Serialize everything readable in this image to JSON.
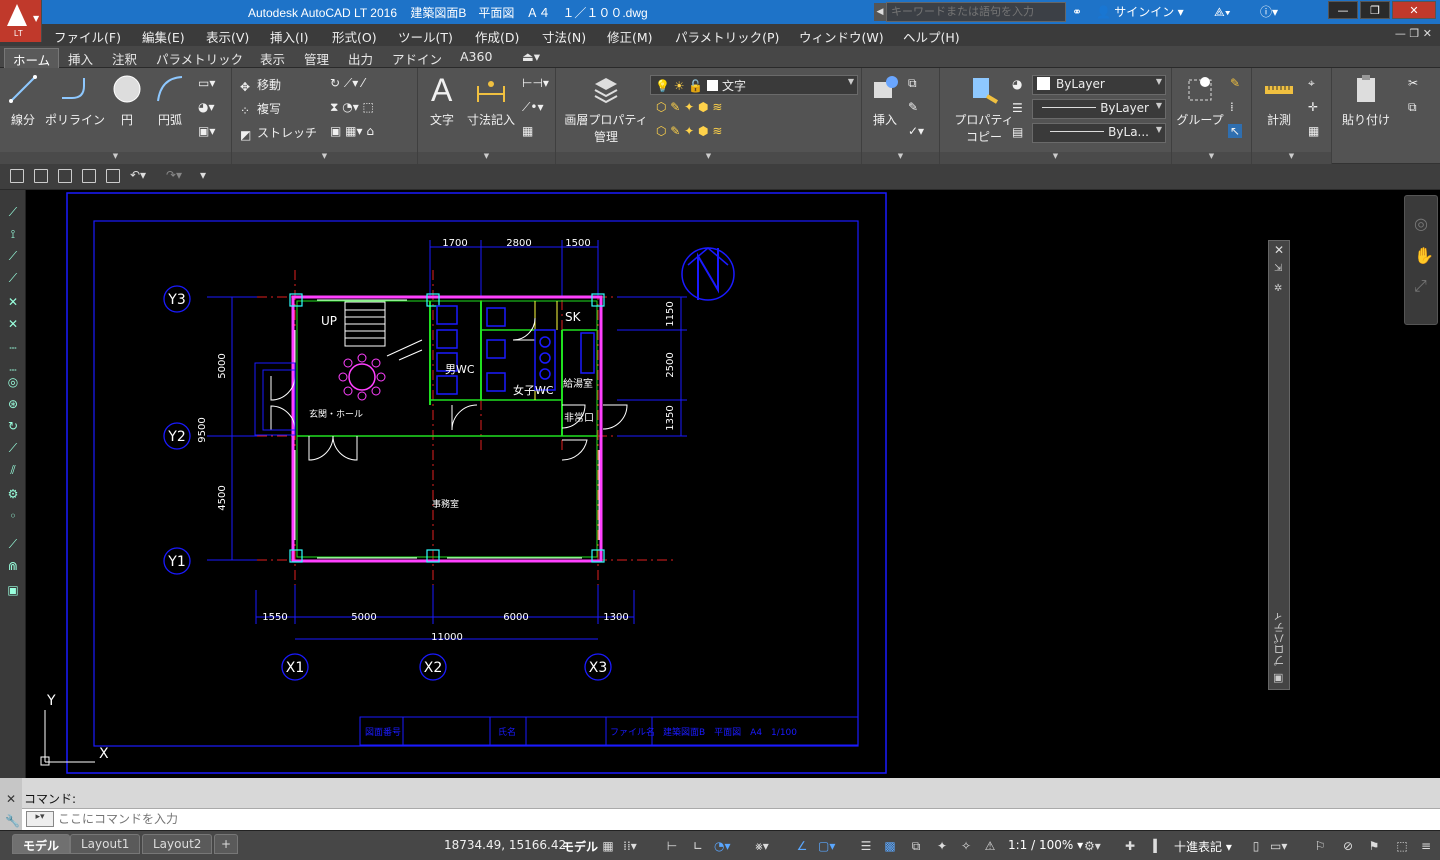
{
  "titlebar": {
    "title": "Autodesk AutoCAD LT 2016    建築図面B　平面図　Ａ４　１／１００.dwg",
    "logo_text": "LT",
    "search_placeholder": "キーワードまたは語句を入力",
    "signin": "サインイン"
  },
  "menu": {
    "items": [
      "ファイル(F)",
      "編集(E)",
      "表示(V)",
      "挿入(I)",
      "形式(O)",
      "ツール(T)",
      "作成(D)",
      "寸法(N)",
      "修正(M)",
      "パラメトリック(P)",
      "ウィンドウ(W)",
      "ヘルプ(H)"
    ]
  },
  "ribbon_tabs": [
    "ホーム",
    "挿入",
    "注釈",
    "パラメトリック",
    "表示",
    "管理",
    "出力",
    "アドイン",
    "A360"
  ],
  "ribbon": {
    "draw": {
      "line": "線分",
      "polyline": "ポリライン",
      "circle": "円",
      "arc": "円弧"
    },
    "modify": {
      "move": "移動",
      "copy": "複写",
      "stretch": "ストレッチ"
    },
    "annotation": {
      "text": "文字",
      "dimension": "寸法記入"
    },
    "layers": {
      "layer_props": "画層プロパティ",
      "layer_props2": "管理",
      "current_layer": "文字"
    },
    "block": {
      "insert": "挿入"
    },
    "properties": {
      "match": "プロパティ",
      "match2": "コピー",
      "color": "ByLayer",
      "linetype": "ByLayer",
      "lineweight": "ByLa..."
    },
    "groups": {
      "group": "グループ"
    },
    "utilities": {
      "measure": "計測"
    },
    "clipboard": {
      "paste": "貼り付け"
    }
  },
  "drawing": {
    "grid_y": [
      "Y3",
      "Y2",
      "Y1"
    ],
    "grid_x": [
      "X1",
      "X2",
      "X3"
    ],
    "dims_top": [
      "1700",
      "2800",
      "1500"
    ],
    "dims_right": [
      "1150",
      "2500",
      "1350"
    ],
    "dims_left": [
      "5000",
      "9500",
      "4500"
    ],
    "dims_bottom": [
      "1550",
      "5000",
      "6000",
      "1300"
    ],
    "dim_total": "11000",
    "rooms": {
      "up": "UP",
      "sk": "SK",
      "mens_wc": "男WC",
      "womens_wc": "女子WC",
      "kitchenette": "給湯室",
      "entrance_hall": "玄関・ホール",
      "emergency_exit": "非常口",
      "office": "事務室"
    },
    "title_block": {
      "drawing_no_label": "図面番号",
      "name_label": "氏名",
      "file_label": "ファイル名",
      "file_value": "建築図面B　平面図　A4　1/100"
    },
    "ucs_x": "X",
    "ucs_y": "Y"
  },
  "properties_palette": {
    "label": "プロパティ"
  },
  "command": {
    "history": "コマンド:",
    "placeholder": "ここにコマンドを入力"
  },
  "status": {
    "layout_tabs": [
      "モデル",
      "Layout1",
      "Layout2"
    ],
    "add_tab": "+",
    "coords": "18734.49, 15166.42",
    "model": "モデル",
    "scale": "1:1 / 100%",
    "units": "十進表記"
  },
  "colors": {
    "titlebar": "#1e73c8",
    "drawing_blue": "#1a1aff",
    "wall_magenta": "#ff40ff",
    "wall_green": "#20e020",
    "grid_red": "#e02020",
    "text_white": "#ffffff"
  }
}
